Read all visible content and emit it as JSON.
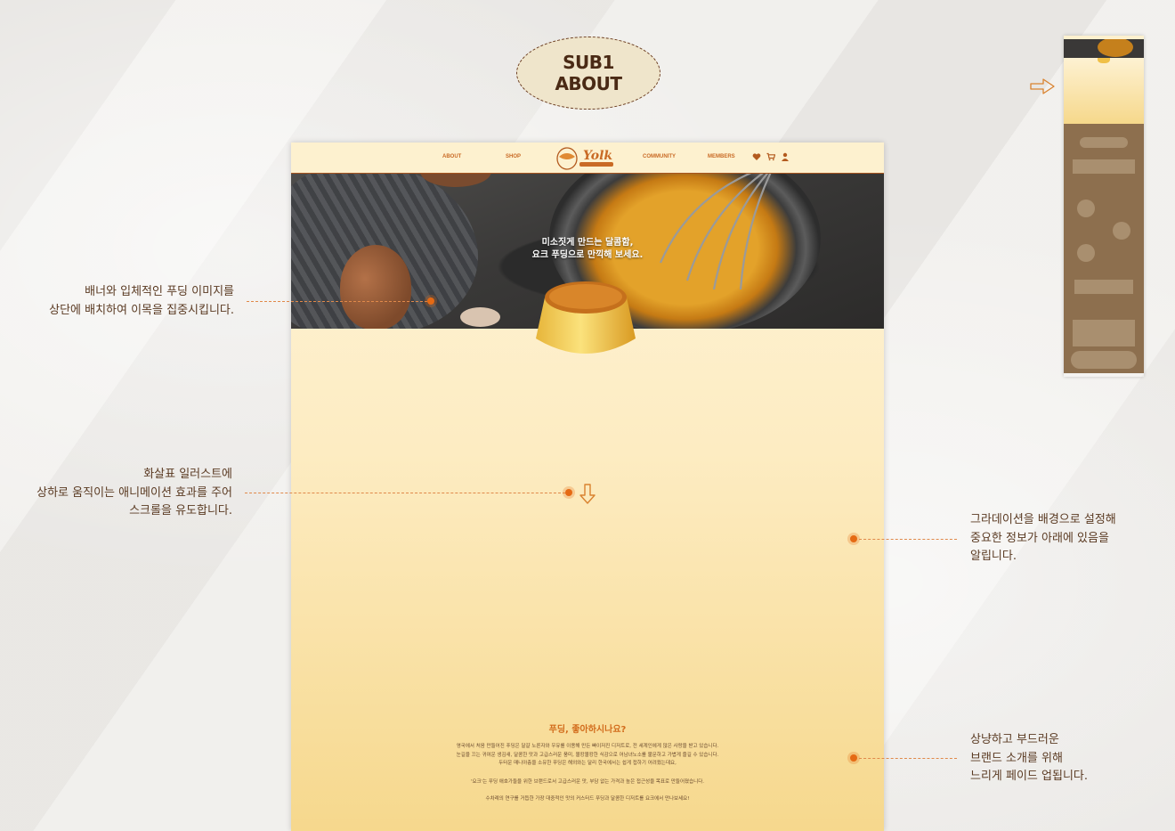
{
  "badge": {
    "line1": "SUB1",
    "line2": "ABOUT"
  },
  "nav": {
    "about": "ABOUT",
    "shop": "SHOP",
    "community": "COMMUNITY",
    "members": "MEMBERS",
    "logo_text": "Yolk",
    "icons": [
      "heart-icon",
      "cart-icon",
      "user-icon"
    ]
  },
  "hero": {
    "line1": "미소짓게 만드는 달콤함,",
    "line2": "요크 푸딩으로 만끽해 보세요."
  },
  "intro": {
    "title": "푸딩, 좋아하시나요?",
    "p1": "영국에서 처음 만들어진 푸딩은 달걀 노른자와 우유를 이용해 만든 빠이저진 디저트로, 전 세계인에게 많은 사랑을 받고 있습니다.",
    "p2": "눈길을 끄는 귀여운 생김새, 달콤한 맛과 고급스러운 풍미, 몰캉몰캉한 식감으로 어남녀노소를 불문하고 가볍게 즐길 수 있습니다.",
    "p3": "두터운 매니아층을 소유한 푸딩은 해외와는 달리 한국에서는 쉽게 접하기 어려웠는데요,",
    "p4": "'요크'는 푸딩 애호가들을 위한 브랜드로서 고급스러운 맛, 부담 없는 가격과 높은 접근성을 목표로 만들어졌습니다.",
    "p5": "수차례의 연구를 거듭한 가장 대중적인 맛의 커스터드 푸딩과 달콤한 디저트를 요크에서 만나보세요!"
  },
  "notes": {
    "banner_1": "배너와 입체적인 푸딩 이미지를",
    "banner_2": "상단에 배치하여 이목을 집중시킵니다.",
    "arrow_1": "화살표 일러스트에",
    "arrow_2": "상하로 움직이는 애니메이션 효과를 주어",
    "arrow_3": "스크롤을 유도합니다.",
    "grad_1": "그라데이션을 배경으로 설정해",
    "grad_2": "중요한 정보가 아래에 있음을",
    "grad_3": "알립니다.",
    "fade_1": "상냥하고 부드러운",
    "fade_2": "브랜드 소개를 위해",
    "fade_3": "느리게 페이드 업됩니다."
  },
  "colors": {
    "accent": "#e56a14",
    "brand": "#c96a25",
    "text": "#5a3a22"
  }
}
